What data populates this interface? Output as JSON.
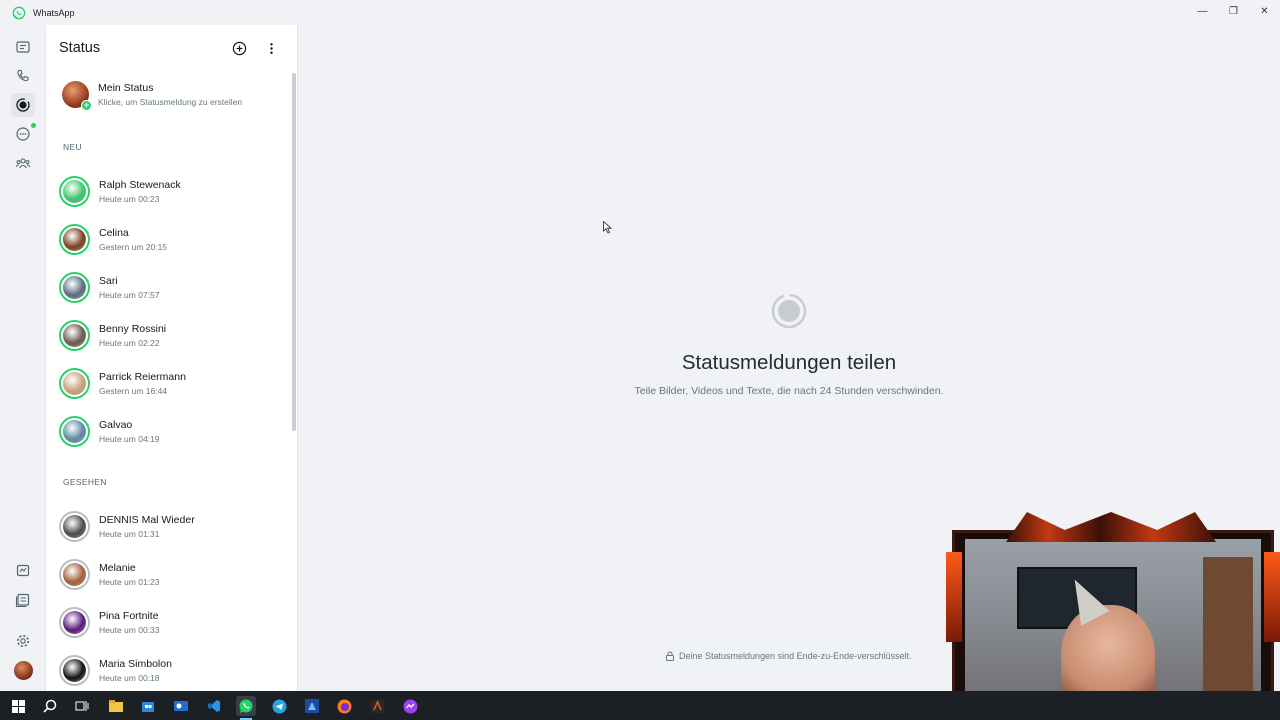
{
  "window": {
    "title": "WhatsApp",
    "brand_color": "#25d366",
    "controls": [
      "minimize-icon",
      "restore-icon",
      "close-icon"
    ]
  },
  "rail": {
    "items": [
      {
        "icon": "chats-icon",
        "label": "Chats"
      },
      {
        "icon": "calls-icon",
        "label": "Anrufe"
      },
      {
        "icon": "status-icon",
        "label": "Status",
        "active": true
      },
      {
        "icon": "channels-icon",
        "label": "Kanäle"
      },
      {
        "icon": "communities-icon",
        "label": "Communitys"
      }
    ],
    "bottom": [
      {
        "icon": "starred-messages-icon"
      },
      {
        "icon": "archive-icon"
      },
      {
        "icon": "settings-icon"
      },
      {
        "icon": "profile-avatar"
      }
    ]
  },
  "status_panel": {
    "title": "Status",
    "my_status": {
      "name": "Mein Status",
      "hint": "Klicke, um Statusmeldung zu erstellen"
    },
    "sections": {
      "new_label": "NEU",
      "seen_label": "GESEHEN"
    },
    "new": [
      {
        "name": "Ralph Stewenack",
        "time": "Heute um 00:23",
        "color": "#3fc56a"
      },
      {
        "name": "Celina",
        "time": "Gestern um 20:15",
        "color": "#7a4020"
      },
      {
        "name": "Sari",
        "time": "Heute um 07:57",
        "color": "#5a6e7e"
      },
      {
        "name": "Benny Rossini",
        "time": "Heute um 02:22",
        "color": "#6a5a50"
      },
      {
        "name": "Parrick Reiermann",
        "time": "Gestern um 16:44",
        "color": "#c9a07a"
      },
      {
        "name": "Galvao",
        "time": "Heute um 04:19",
        "color": "#5a8aa0"
      }
    ],
    "seen": [
      {
        "name": "DENNIS Mal Wieder",
        "time": "Heute um 01:31",
        "color": "#4a4a4a"
      },
      {
        "name": "Melanie",
        "time": "Heute um 01:23",
        "color": "#a0603a"
      },
      {
        "name": "Pina Fortnite",
        "time": "Heute um 00:33",
        "color": "#5a1a7a"
      },
      {
        "name": "Maria Simbolon",
        "time": "Heute um 00:18",
        "color": "#111111"
      }
    ]
  },
  "main": {
    "title": "Statusmeldungen teilen",
    "subtitle": "Teile Bilder, Videos und Texte, die nach 24 Stunden verschwinden.",
    "encryption_note": "Deine Statusmeldungen sind Ende-zu-Ende-verschlüsselt."
  },
  "taskbar": {
    "icons": [
      "start-icon",
      "search-icon",
      "task-view-icon",
      "file-explorer-icon",
      "store-icon",
      "outlook-icon",
      "vs-code-icon",
      "whatsapp-icon",
      "telegram-icon",
      "azure-icon",
      "firefox-icon",
      "app-icon",
      "messenger-icon"
    ],
    "active": "whatsapp-icon"
  }
}
